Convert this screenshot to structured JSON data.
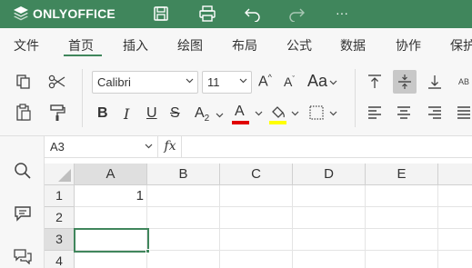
{
  "app": {
    "brand": "ONLYOFFICE",
    "brand_color": "#40865c"
  },
  "titlebar": {
    "icons": [
      "save-icon",
      "print-icon",
      "undo-icon",
      "redo-icon",
      "more-icon"
    ],
    "more_label": "···"
  },
  "menu": {
    "tabs": [
      {
        "label": "文件"
      },
      {
        "label": "首页",
        "active": true
      },
      {
        "label": "插入"
      },
      {
        "label": "绘图"
      },
      {
        "label": "布局"
      },
      {
        "label": "公式"
      },
      {
        "label": "数据"
      },
      {
        "label": "协作"
      },
      {
        "label": "保护"
      }
    ]
  },
  "toolbar": {
    "font_name": "Calibri",
    "font_size": "11",
    "increase_font_label": "A",
    "decrease_font_label": "A",
    "change_case_label": "Aa",
    "bold_label": "B",
    "italic_label": "I",
    "underline_label": "U",
    "strike_label": "S",
    "subscript_label": "A",
    "subscript_sub": "2",
    "font_color_label": "A",
    "font_color": "#e00000",
    "fill_color": "#ffff00",
    "wrap_label": "AB"
  },
  "formula_bar": {
    "name_box": "A3",
    "fx_label": "fx",
    "formula": ""
  },
  "sheet": {
    "columns": [
      "A",
      "B",
      "C",
      "D",
      "E"
    ],
    "rows": [
      "1",
      "2",
      "3",
      "4"
    ],
    "selected_column": "A",
    "selected_row": "3",
    "cells": {
      "A1": "1"
    }
  }
}
